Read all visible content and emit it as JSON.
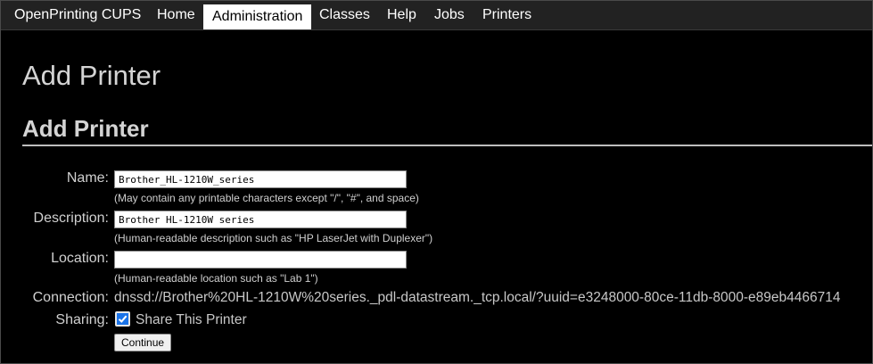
{
  "nav": {
    "brand": "OpenPrinting CUPS",
    "items": [
      "Home",
      "Administration",
      "Classes",
      "Help",
      "Jobs",
      "Printers"
    ],
    "active": "Administration"
  },
  "page": {
    "title": "Add Printer",
    "section_title": "Add Printer"
  },
  "form": {
    "name": {
      "label": "Name:",
      "value": "Brother_HL-1210W_series",
      "help": "(May contain any printable characters except \"/\", \"#\", and space)"
    },
    "description": {
      "label": "Description:",
      "value": "Brother HL-1210W series",
      "help": "(Human-readable description such as \"HP LaserJet with Duplexer\")"
    },
    "location": {
      "label": "Location:",
      "value": "",
      "help": "(Human-readable location such as \"Lab 1\")"
    },
    "connection": {
      "label": "Connection:",
      "value": "dnssd://Brother%20HL-1210W%20series._pdl-datastream._tcp.local/?uuid=e3248000-80ce-11db-8000-e89eb4466714"
    },
    "sharing": {
      "label": "Sharing:",
      "checked": true,
      "checkbox_label": "Share This Printer"
    },
    "submit_label": "Continue"
  },
  "colors": {
    "background": "#000000",
    "nav_background": "#222222",
    "active_tab": "#ffffff",
    "heading": "#d4d4d4",
    "checkbox_accent": "#1a73e8"
  },
  "icons": {
    "checkbox": "checkmark-icon"
  }
}
